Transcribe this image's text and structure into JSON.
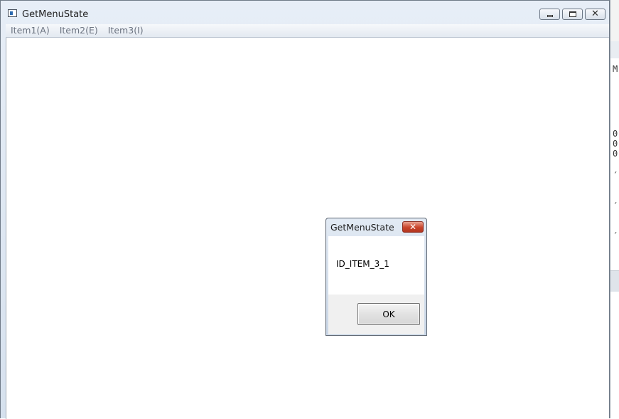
{
  "window": {
    "title": "GetMenuState",
    "min_glyph": "",
    "max_glyph": "",
    "close_glyph": "✕"
  },
  "menu": {
    "items": [
      "Item1(A)",
      "Item2(E)",
      "Item3(I)"
    ]
  },
  "dialog": {
    "title": "GetMenuState",
    "close_glyph": "✕",
    "message": "ID_ITEM_3_1",
    "ok_label": "OK"
  },
  "background_window": {
    "glyphs": [
      "M",
      "0",
      "0",
      "0",
      "´",
      "´",
      "´"
    ]
  },
  "colors": {
    "title_bar": "#dfe8f3",
    "dialog_close": "#c9442b"
  }
}
